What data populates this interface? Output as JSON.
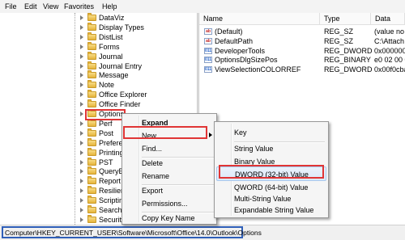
{
  "menubar": {
    "file": "File",
    "edit": "Edit",
    "view": "View",
    "favorites": "Favorites",
    "help": "Help"
  },
  "tree": {
    "items": [
      "DataViz",
      "Display Types",
      "DistList",
      "Forms",
      "Journal",
      "Journal Entry",
      "Message",
      "Note",
      "Office Explorer",
      "Office Finder",
      "Options",
      "Perf",
      "Post",
      "Preferen",
      "Printing",
      "PST",
      "QueryBu",
      "Report",
      "Resilien",
      "Scripting",
      "Search",
      "Security"
    ]
  },
  "list": {
    "headers": {
      "name": "Name",
      "type": "Type",
      "data": "Data"
    },
    "rows": [
      {
        "icon": "ab",
        "name": "(Default)",
        "type": "REG_SZ",
        "data": "(value no"
      },
      {
        "icon": "ab",
        "name": "DefaultPath",
        "type": "REG_SZ",
        "data": "C:\\Attach"
      },
      {
        "icon": "bin",
        "name": "DeveloperTools",
        "type": "REG_DWORD",
        "data": "0x000000"
      },
      {
        "icon": "bin",
        "name": "OptionsDlgSizePos",
        "type": "REG_BINARY",
        "data": "e0 02 00 0"
      },
      {
        "icon": "bin",
        "name": "ViewSelectionCOLORREF",
        "type": "REG_DWORD",
        "data": "0x00f0cba"
      }
    ]
  },
  "context_menu": {
    "expand": "Expand",
    "new": "New",
    "find": "Find...",
    "delete": "Delete",
    "rename": "Rename",
    "export": "Export",
    "permissions": "Permissions...",
    "copy_key_name": "Copy Key Name"
  },
  "submenu": {
    "key": "Key",
    "string": "String Value",
    "binary": "Binary Value",
    "dword": "DWORD (32-bit) Value",
    "qword": "QWORD (64-bit) Value",
    "multi": "Multi-String Value",
    "expandable": "Expandable String Value"
  },
  "status": {
    "path": "Computer\\HKEY_CURRENT_USER\\Software\\Microsoft\\Office\\14.0\\Outlook\\Options"
  },
  "colors": {
    "highlight_box": "#e03535",
    "status_box": "#2f5fb8"
  }
}
